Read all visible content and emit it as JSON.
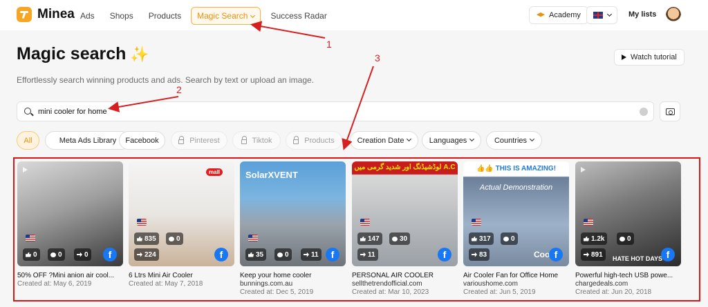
{
  "app": {
    "logo_text": "Minea",
    "nav": [
      {
        "label": "Ads"
      },
      {
        "label": "Shops"
      },
      {
        "label": "Products"
      },
      {
        "label": "Magic Search"
      },
      {
        "label": "Success Radar"
      }
    ],
    "academy_label": "Academy",
    "mylists_label": "My lists",
    "language_flag": "uk-flag-icon"
  },
  "header": {
    "title": "Magic search",
    "title_emoji": "✨",
    "subtitle": "Effortlessly search winning products and ads. Search by text or upload an image.",
    "watch_tutorial_label": "Watch tutorial"
  },
  "search": {
    "value": "mini cooler for home",
    "placeholder": ""
  },
  "filters": {
    "all": "All",
    "meta_ads_library": "Meta Ads Library",
    "facebook": "Facebook",
    "pinterest": "Pinterest",
    "tiktok": "Tiktok",
    "products": "Products",
    "creation_date": "Creation Date",
    "languages": "Languages",
    "countries": "Countries"
  },
  "annotations": {
    "step1": "1",
    "step2": "2",
    "step3": "3",
    "color": "#d62020"
  },
  "results": [
    {
      "title": "50% OFF ?Mini anion air cool...",
      "domain": "",
      "created": "Created at: May 6, 2019",
      "likes": "0",
      "comments": "0",
      "shares": "0",
      "country": "US"
    },
    {
      "title": "6 Ltrs Mini Air Cooler",
      "domain": "",
      "created": "Created at: May 7, 2018",
      "likes": "835",
      "comments": "0",
      "shares": "224",
      "country": "US",
      "shop_tag": "mall"
    },
    {
      "title": "Keep your home cooler",
      "domain": "bunnings.com.au",
      "created": "Created at: Dec 5, 2019",
      "likes": "35",
      "comments": "0",
      "shares": "11",
      "country": "US",
      "brand_tag": "SolarXVENT"
    },
    {
      "title": "PERSONAL AIR COOLER",
      "domain": "sellthetrendofficial.com",
      "created": "Created at: Mar 10, 2023",
      "likes": "147",
      "comments": "30",
      "shares": "11",
      "country": "US",
      "banner": "لوڈشیڈنگ اور شدید گرمی میں A.C"
    },
    {
      "title": "Air Cooler Fan for Office Home",
      "domain": "varioushome.com",
      "created": "Created at: Jun 5, 2019",
      "likes": "317",
      "comments": "0",
      "shares": "83",
      "country": "US",
      "banner": "👍👍 THIS IS AMAZING!",
      "banner2": "Actual Demonstration",
      "overlay_text": "Cool"
    },
    {
      "title": "Powerful high-tech USB powe...",
      "domain": "chargedeals.com",
      "created": "Created at: Jun 20, 2018",
      "likes": "1.2k",
      "comments": "0",
      "shares": "891",
      "country": "US",
      "overlay_text": "HATE HOT DAYS"
    }
  ],
  "colors": {
    "accent": "#e8920f",
    "facebook": "#1877f2",
    "highlight_frame": "#e01414"
  }
}
